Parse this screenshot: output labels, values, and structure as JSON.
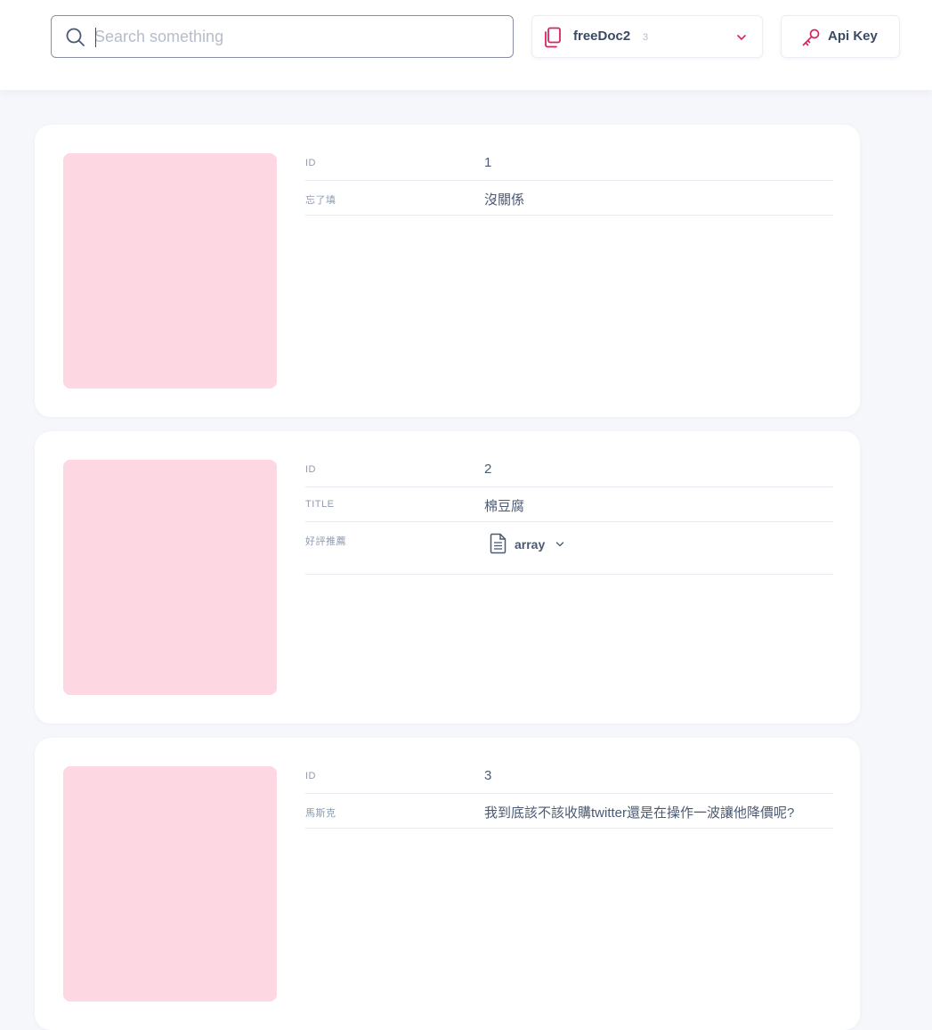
{
  "search": {
    "placeholder": "Search something",
    "value": ""
  },
  "collection": {
    "name": "freeDoc2",
    "count": "3"
  },
  "api_key": {
    "label": "Api Key"
  },
  "accent_color": "#d8245c",
  "thumbnail_color": "#fdd7e2",
  "documents": [
    {
      "fields": [
        {
          "key": "ID",
          "value": "1"
        },
        {
          "key": "忘了填",
          "value": "沒關係"
        }
      ]
    },
    {
      "fields": [
        {
          "key": "ID",
          "value": "2"
        },
        {
          "key": "TITLE",
          "value": "棉豆腐"
        },
        {
          "key": "好評推薦",
          "value": "array"
        }
      ]
    },
    {
      "fields": [
        {
          "key": "ID",
          "value": "3"
        },
        {
          "key": "馬斯克",
          "value": "我到底該不該收購twitter還是在操作一波讓他降價呢?"
        }
      ]
    }
  ]
}
